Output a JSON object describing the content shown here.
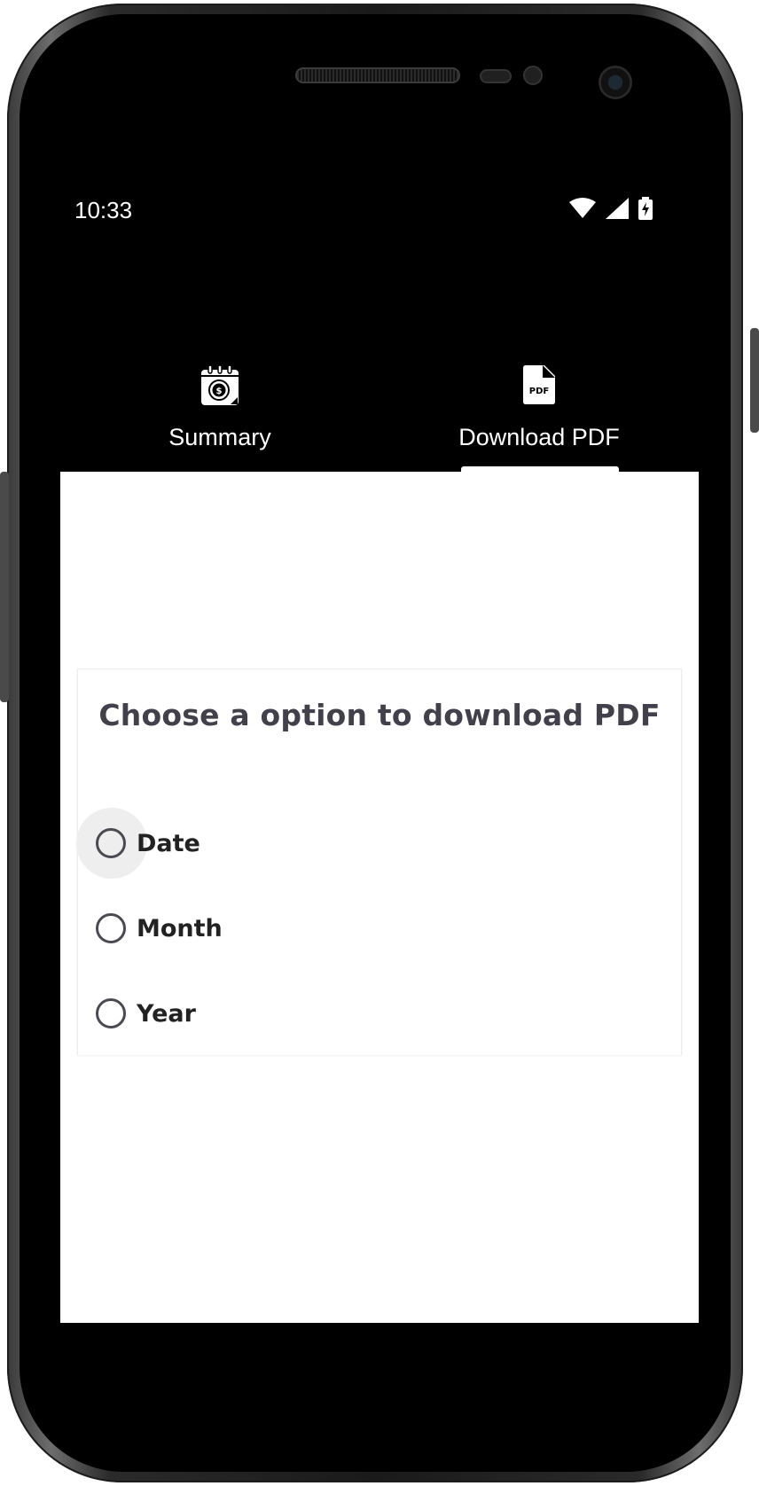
{
  "status_bar": {
    "time": "10:33",
    "icons": [
      "wifi-icon",
      "cellular-signal-icon",
      "battery-charging-icon"
    ]
  },
  "tabs": [
    {
      "label": "Summary",
      "icon": "calendar-dollar-icon",
      "selected": false
    },
    {
      "label": "Download PDF",
      "icon": "pdf-file-icon",
      "selected": true
    }
  ],
  "pdf_icon_text": "PDF",
  "card": {
    "title": "Choose a option to download PDF",
    "options": [
      {
        "label": "Date",
        "selected": false,
        "focused": true
      },
      {
        "label": "Month",
        "selected": false,
        "focused": false
      },
      {
        "label": "Year",
        "selected": false,
        "focused": false
      }
    ]
  },
  "colors": {
    "app_bar": "#000000",
    "content_bg": "#ffffff",
    "title_text": "#42404a",
    "radio_border": "#4a4a52"
  }
}
